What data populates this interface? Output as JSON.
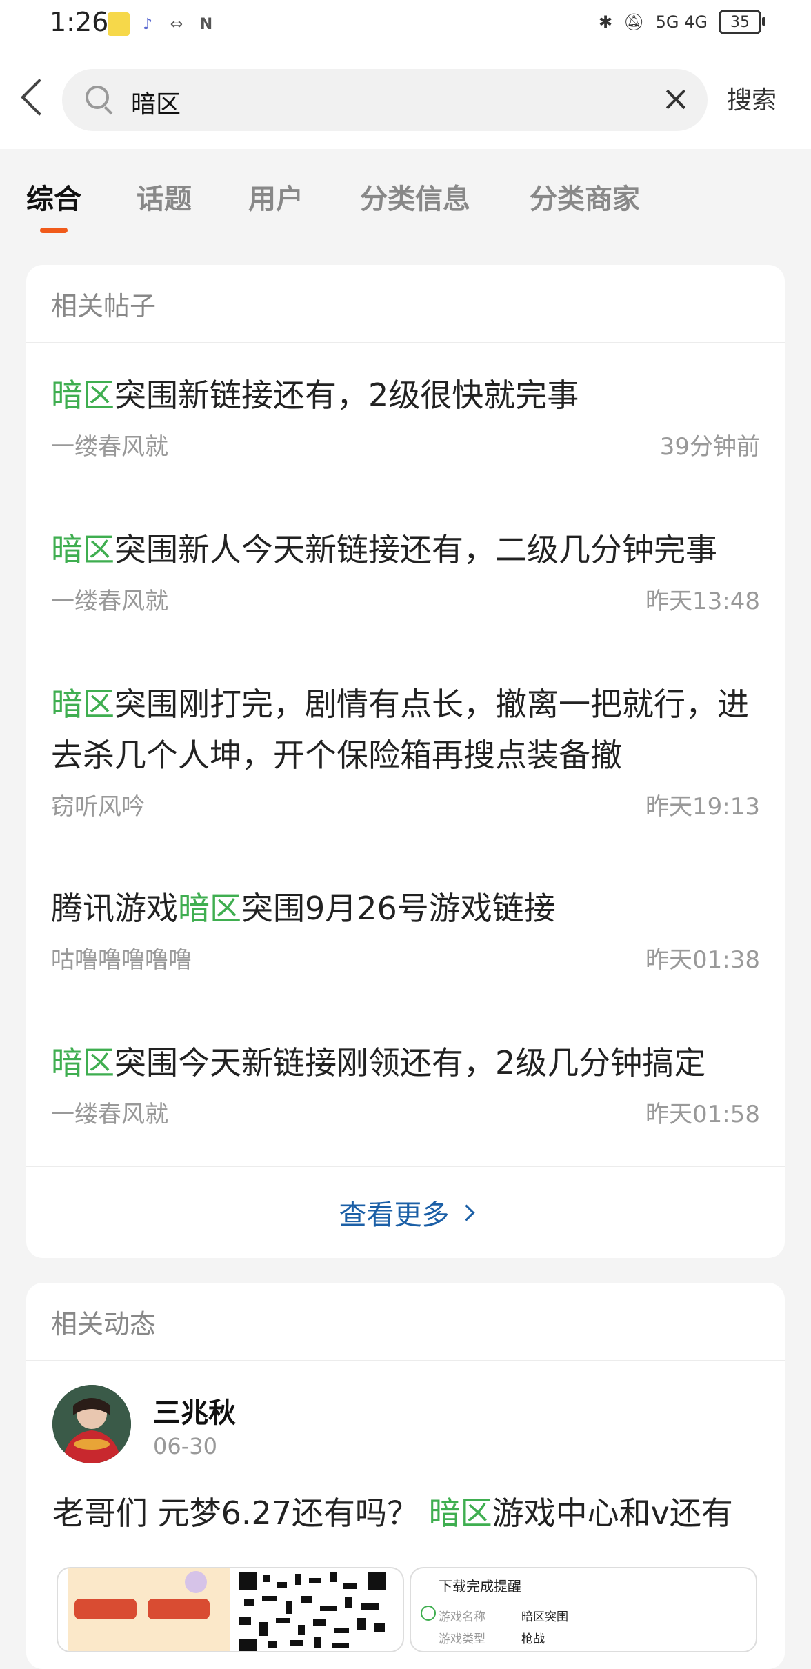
{
  "status_bar": {
    "time": "1:26",
    "network": "5G 4G",
    "battery": "35"
  },
  "search": {
    "query": "暗区",
    "button_label": "搜索"
  },
  "tabs": [
    {
      "label": "综合"
    },
    {
      "label": "话题"
    },
    {
      "label": "用户"
    },
    {
      "label": "分类信息"
    },
    {
      "label": "分类商家"
    }
  ],
  "posts_section": {
    "header": "相关帖子",
    "posts": [
      {
        "pre": "",
        "hl": "暗区",
        "post": "突围新链接还有，2级很快就完事",
        "author": "一缕春风就",
        "time": "39分钟前"
      },
      {
        "pre": "",
        "hl": "暗区",
        "post": "突围新人今天新链接还有，二级几分钟完事",
        "author": "一缕春风就",
        "time": "昨天13:48"
      },
      {
        "pre": "",
        "hl": "暗区",
        "post": "突围刚打完，剧情有点长，撤离一把就行，进去杀几个人坤，开个保险箱再搜点装备撤",
        "author": "窃听风吟",
        "time": "昨天19:13"
      },
      {
        "pre": "腾讯游戏",
        "hl": "暗区",
        "post": "突围9月26号游戏链接",
        "author": "咕噜噜噜噜噜",
        "time": "昨天01:38"
      },
      {
        "pre": "",
        "hl": "暗区",
        "post": "突围今天新链接刚领还有，2级几分钟搞定",
        "author": "一缕春风就",
        "time": "昨天01:58"
      }
    ],
    "more_label": "查看更多"
  },
  "feed_section": {
    "header": "相关动态",
    "user": "三兆秋",
    "date": "06-30",
    "text_pre": "老哥们 元梦6.27还有吗？ ",
    "text_hl": "暗区",
    "text_post": "游戏中心和v还有",
    "thumb2": {
      "title": "下载完成提醒",
      "row1_label": "游戏名称",
      "row1_value": "暗区突围",
      "row2_label": "游戏类型",
      "row2_value": "枪战"
    }
  },
  "colors": {
    "accent": "#f05a1a",
    "highlight": "#3fae50",
    "link": "#1b5fa6"
  }
}
